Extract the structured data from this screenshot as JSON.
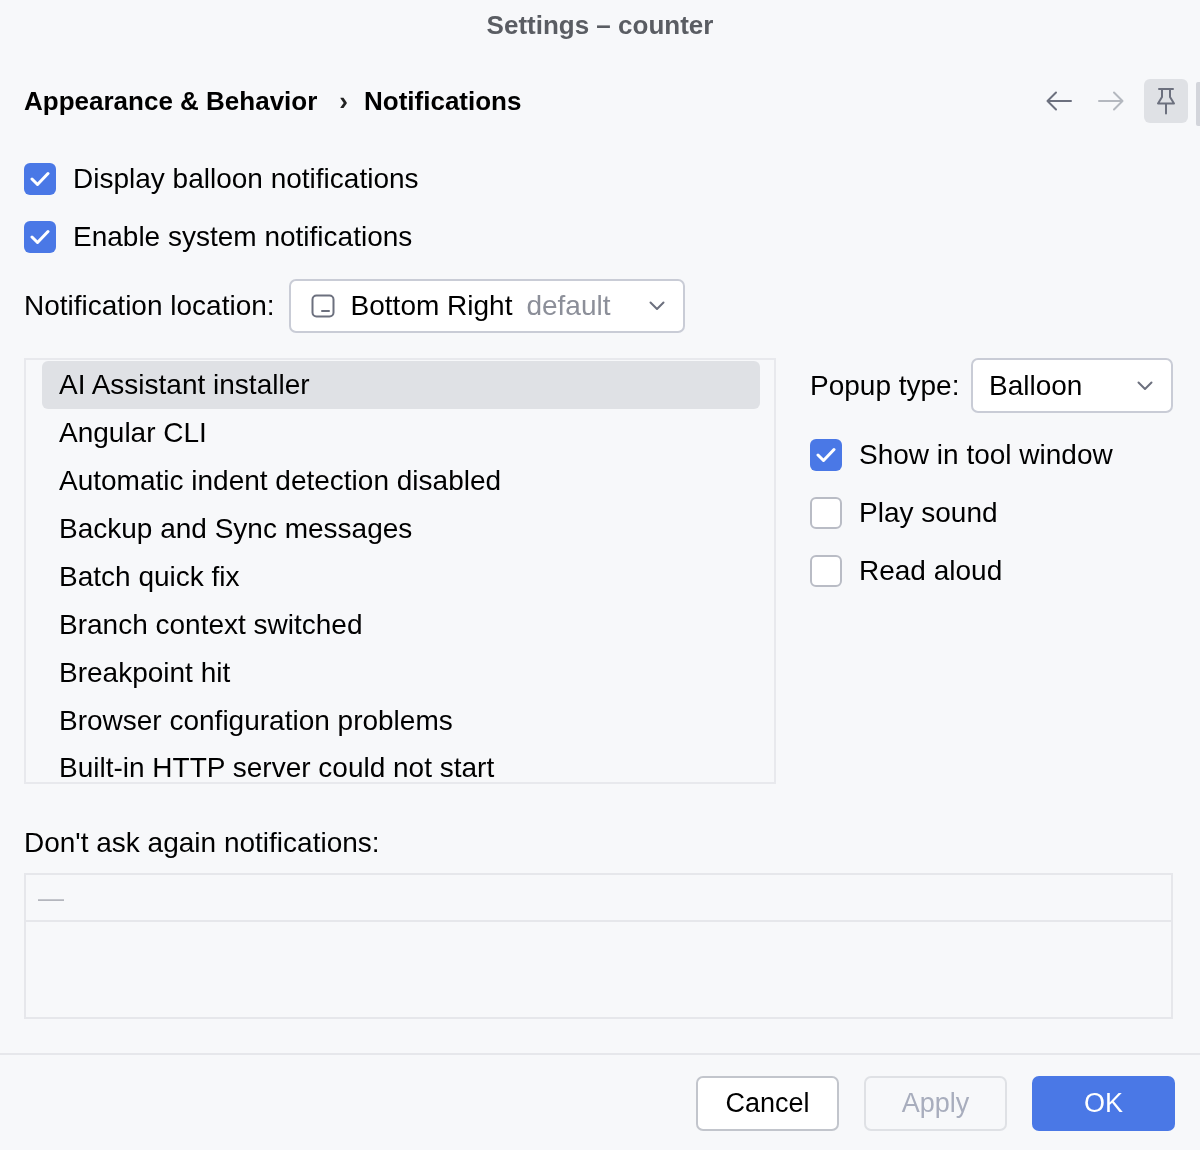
{
  "window": {
    "title": "Settings – counter"
  },
  "breadcrumb": {
    "items": [
      "Appearance & Behavior",
      "Notifications"
    ],
    "separator": "›"
  },
  "nav": {
    "back": {
      "disabled": false
    },
    "forward": {
      "disabled": true
    },
    "pin": {
      "on": true
    }
  },
  "general_options": [
    {
      "label": "Display balloon notifications",
      "checked": true
    },
    {
      "label": "Enable system notifications",
      "checked": true
    }
  ],
  "location": {
    "label": "Notification location:",
    "value": "Bottom Right",
    "note": "default"
  },
  "groups": [
    {
      "label": "AI Assistant installer",
      "selected": true
    },
    {
      "label": "Angular CLI",
      "selected": false
    },
    {
      "label": "Automatic indent detection disabled",
      "selected": false
    },
    {
      "label": "Backup and Sync messages",
      "selected": false
    },
    {
      "label": "Batch quick fix",
      "selected": false
    },
    {
      "label": "Branch context switched",
      "selected": false
    },
    {
      "label": "Breakpoint hit",
      "selected": false
    },
    {
      "label": "Browser configuration problems",
      "selected": false
    },
    {
      "label": "Built-in HTTP server could not start",
      "selected": false
    }
  ],
  "popup": {
    "label": "Popup type:",
    "value": "Balloon"
  },
  "group_options": [
    {
      "label": "Show in tool window",
      "checked": true
    },
    {
      "label": "Play sound",
      "checked": false
    },
    {
      "label": "Read aloud",
      "checked": false
    }
  ],
  "dont_ask": {
    "label": "Don't ask again notifications:",
    "column_header": "—"
  },
  "buttons": [
    {
      "label": "Cancel",
      "kind": "secondary",
      "disabled": false
    },
    {
      "label": "Apply",
      "kind": "secondary",
      "disabled": true
    },
    {
      "label": "OK",
      "kind": "primary",
      "disabled": false
    }
  ]
}
